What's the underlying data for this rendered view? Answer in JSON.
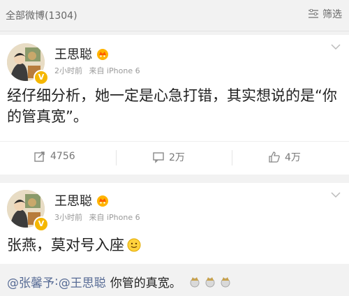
{
  "header": {
    "title": "全部微博(1304)",
    "filter_label": "筛选"
  },
  "posts": [
    {
      "user_name": "王思聪",
      "time": "2小时前",
      "source": "来自 iPhone 6",
      "text": "经仔细分析，她一定是心急打错，其实想说的是“你的管真宽”。",
      "actions": {
        "repost": "4756",
        "comment": "2万",
        "like": "4万"
      }
    },
    {
      "user_name": "王思聪",
      "time": "3小时前",
      "source": "来自 iPhone 6",
      "text": "张燕，莫对号入座"
    }
  ],
  "reply": {
    "mention1": "@张馨予",
    "sep": ":",
    "mention2": "@王思聪",
    "text": "你管的真宽。"
  },
  "colors": {
    "link": "#576b95",
    "vip": "#f5b700",
    "background": "#f2f2f2"
  },
  "icons": [
    "filter-icon",
    "crown-icon",
    "chevron-down-icon",
    "repost-icon",
    "comment-icon",
    "like-icon",
    "smiley-icon"
  ]
}
